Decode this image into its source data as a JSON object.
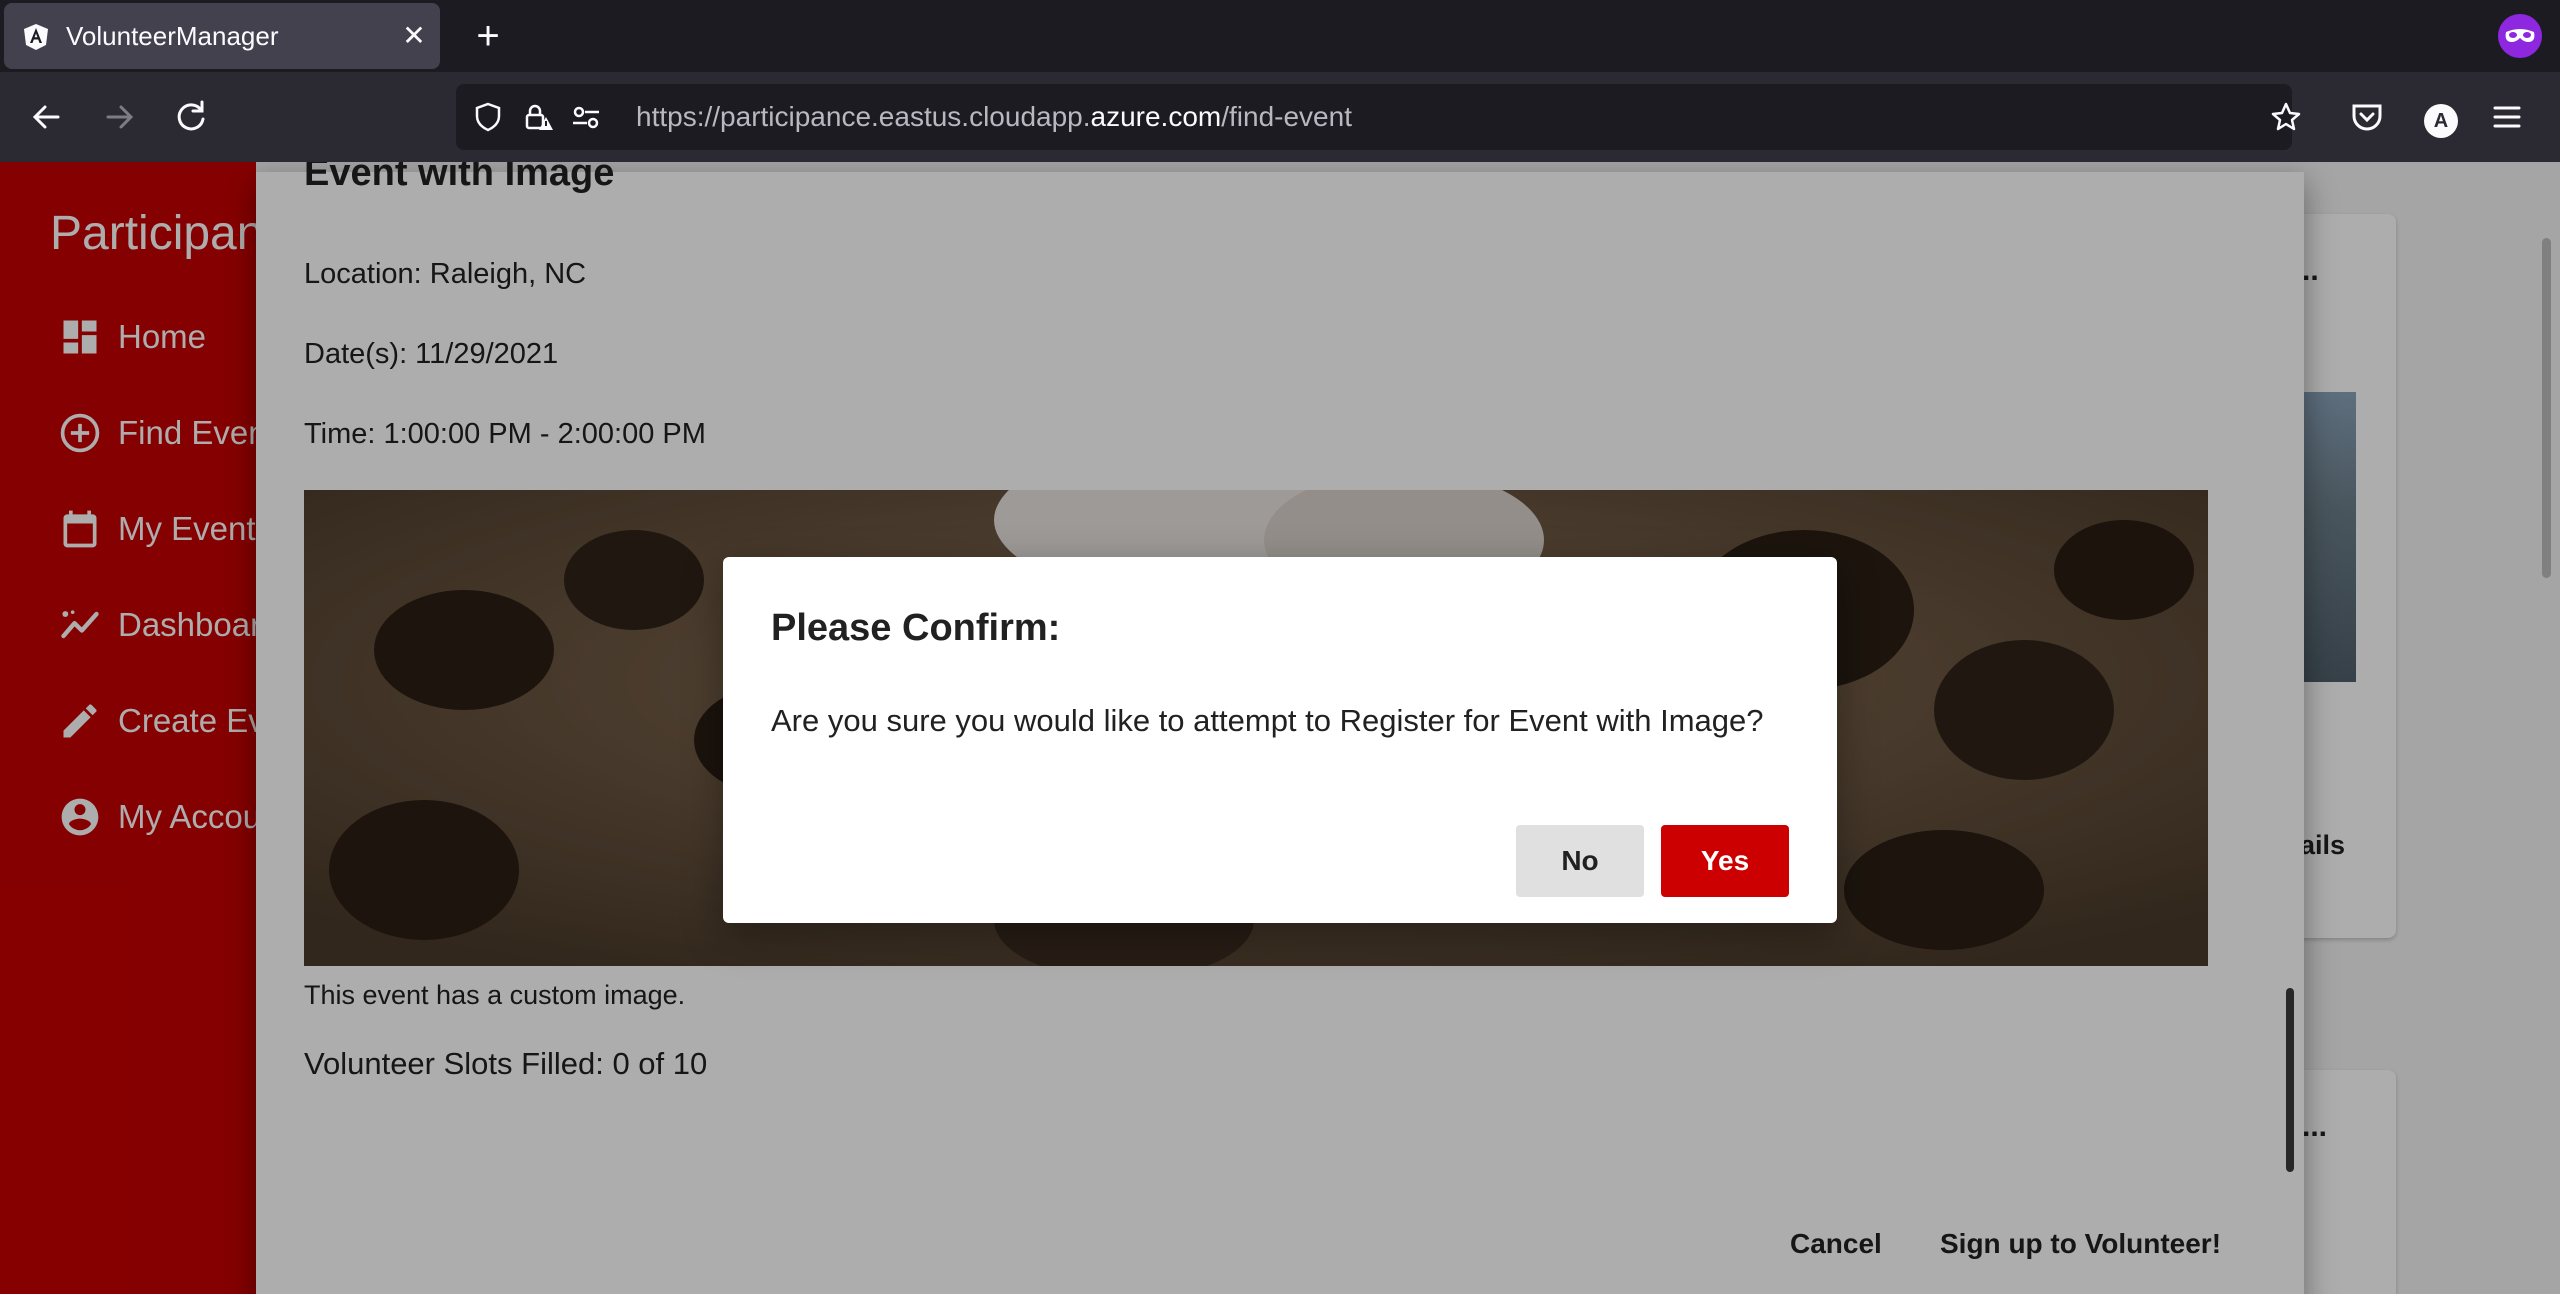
{
  "browser": {
    "tab_title": "VolunteerManager",
    "url_scheme": "https://",
    "url_sub": "participance.eastus.cloudapp.",
    "url_host": "azure.com",
    "url_path": "/find-event",
    "account_initial": "A"
  },
  "sidebar": {
    "brand": "Participance",
    "items": [
      {
        "label": "Home",
        "icon": "dashboard-icon"
      },
      {
        "label": "Find Events",
        "icon": "add-circle-icon"
      },
      {
        "label": "My Events",
        "icon": "calendar-icon"
      },
      {
        "label": "Dashboard",
        "icon": "chart-line-icon"
      },
      {
        "label": "Create Event",
        "icon": "pencil-icon"
      },
      {
        "label": "My Account",
        "icon": "account-circle-icon"
      }
    ]
  },
  "background": {
    "card_dots_1": "..",
    "card_details": "ails",
    "card_dots_2": "..."
  },
  "event_dialog": {
    "title": "Event with Image",
    "location": "Location: Raleigh, NC",
    "dates": "Date(s): 11/29/2021",
    "time": "Time: 1:00:00 PM - 2:00:00 PM",
    "caption": "This event has a custom image.",
    "slots": "Volunteer Slots Filled: 0 of 10",
    "cancel_label": "Cancel",
    "signup_label": "Sign up to Volunteer!"
  },
  "confirm_dialog": {
    "title": "Please Confirm:",
    "message": "Are you sure you would like to attempt to Register for Event with Image?",
    "no_label": "No",
    "yes_label": "Yes"
  },
  "colors": {
    "brand_red": "#c50000",
    "yes_button": "#cc0000",
    "browser_dark": "#1c1b22"
  }
}
